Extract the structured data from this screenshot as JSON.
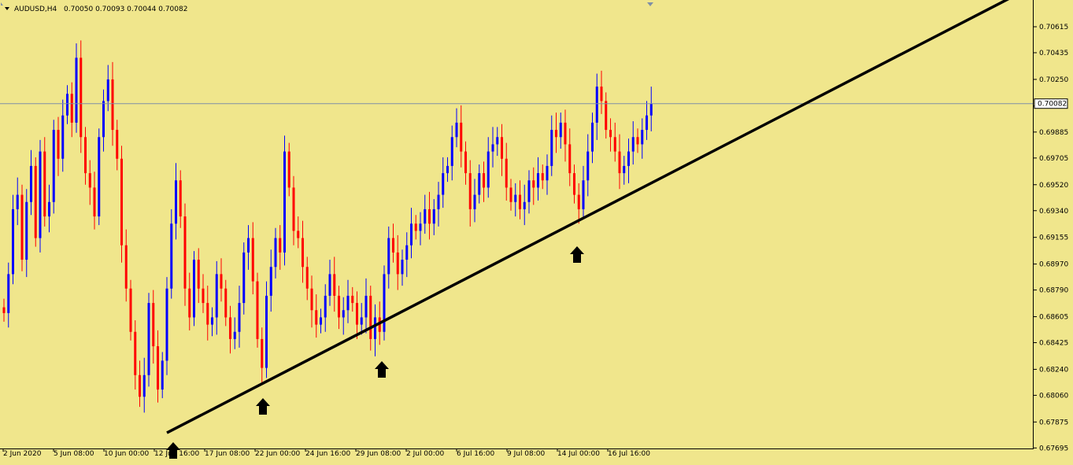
{
  "header": {
    "symbol": "AUDUSD,H4",
    "ohlc": "0.70050 0.70093 0.70044 0.70082"
  },
  "price_axis": {
    "ticks": [
      "0.70615",
      "0.70435",
      "0.70250",
      "0.70065",
      "0.69885",
      "0.69705",
      "0.69520",
      "0.69340",
      "0.69155",
      "0.68970",
      "0.68790",
      "0.68605",
      "0.68425",
      "0.68240",
      "0.68060",
      "0.67875",
      "0.67695"
    ],
    "current_price": "0.70082"
  },
  "time_axis": {
    "labels": [
      "2 Jun 2020",
      "5 Jun 08:00",
      "10 Jun 00:00",
      "12 Jun 16:00",
      "17 Jun 08:00",
      "22 Jun 00:00",
      "24 Jun 16:00",
      "29 Jun 08:00",
      "2 Jul 00:00",
      "6 Jul 16:00",
      "9 Jul 08:00",
      "14 Jul 00:00",
      "16 Jul 16:00"
    ]
  },
  "colors": {
    "background": "#f0e68c",
    "bull": "#0000ff",
    "bear": "#ff0000",
    "trendline": "#000000",
    "price_line": "#7f8fa6"
  },
  "chart_data": {
    "type": "candlestick",
    "title": "AUDUSD,H4",
    "ylim": [
      0.6765,
      0.708
    ],
    "current_price": 0.70082,
    "close_series": [
      0.6863,
      0.689,
      0.6935,
      0.6945,
      0.69,
      0.694,
      0.6965,
      0.6915,
      0.6975,
      0.693,
      0.694,
      0.699,
      0.697,
      0.7,
      0.7015,
      0.6995,
      0.704,
      0.6985,
      0.696,
      0.695,
      0.693,
      0.6985,
      0.701,
      0.7025,
      0.699,
      0.697,
      0.691,
      0.688,
      0.685,
      0.682,
      0.6805,
      0.682,
      0.687,
      0.684,
      0.681,
      0.683,
      0.688,
      0.6925,
      0.6955,
      0.693,
      0.688,
      0.686,
      0.69,
      0.688,
      0.687,
      0.6855,
      0.686,
      0.689,
      0.688,
      0.686,
      0.6845,
      0.685,
      0.687,
      0.6905,
      0.6915,
      0.6885,
      0.6845,
      0.6825,
      0.6875,
      0.6895,
      0.6915,
      0.6905,
      0.6975,
      0.695,
      0.692,
      0.6915,
      0.6895,
      0.688,
      0.6865,
      0.6855,
      0.686,
      0.6875,
      0.689,
      0.6875,
      0.686,
      0.6865,
      0.6875,
      0.687,
      0.6855,
      0.686,
      0.6875,
      0.6845,
      0.686,
      0.685,
      0.689,
      0.6915,
      0.6905,
      0.689,
      0.69,
      0.691,
      0.6925,
      0.692,
      0.6925,
      0.6935,
      0.6925,
      0.6935,
      0.6945,
      0.696,
      0.6965,
      0.6985,
      0.6995,
      0.6975,
      0.696,
      0.6935,
      0.6945,
      0.696,
      0.695,
      0.6975,
      0.698,
      0.6985,
      0.697,
      0.695,
      0.694,
      0.6945,
      0.6935,
      0.694,
      0.6955,
      0.695,
      0.696,
      0.6955,
      0.6965,
      0.699,
      0.6985,
      0.6995,
      0.698,
      0.696,
      0.6945,
      0.6935,
      0.6955,
      0.6975,
      0.6995,
      0.702,
      0.701,
      0.699,
      0.6985,
      0.6975,
      0.696,
      0.6965,
      0.6975,
      0.6985,
      0.698,
      0.699,
      0.7,
      0.7008
    ],
    "trendline": [
      {
        "x": "12 Jun 16:00",
        "y": 0.678
      },
      {
        "x": "beyond 16 Jul 16:00",
        "y": 0.708
      }
    ],
    "markers": [
      {
        "x": "12 Jun 16:00",
        "type": "up-arrow"
      },
      {
        "x": "22 Jun 00:00",
        "type": "up-arrow"
      },
      {
        "x": "29 Jun 08:00",
        "type": "up-arrow"
      },
      {
        "x": "14 Jul 00:00",
        "type": "up-arrow"
      }
    ]
  }
}
